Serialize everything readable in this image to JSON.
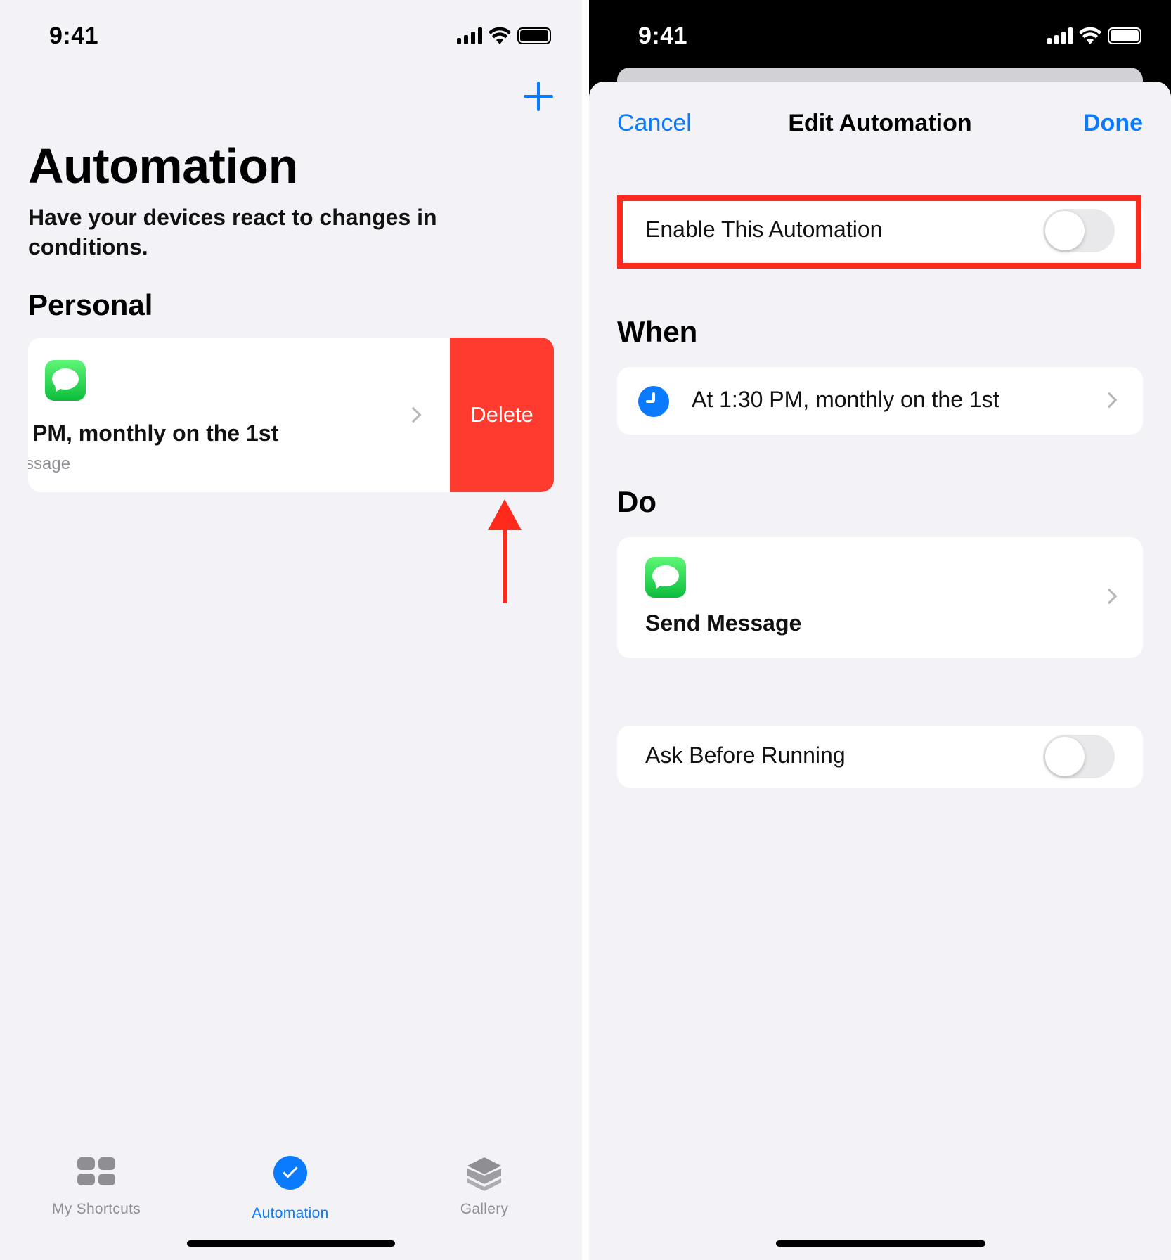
{
  "left": {
    "status": {
      "time": "9:41"
    },
    "header": {
      "title": "Automation",
      "subtitle": "Have your devices react to changes in conditions."
    },
    "section": "Personal",
    "card": {
      "title": "PM, monthly on the 1st",
      "subtitle": "ssage",
      "delete_label": "Delete"
    },
    "tabs": [
      {
        "label": "My Shortcuts",
        "icon": "grid-icon",
        "active": false
      },
      {
        "label": "Automation",
        "icon": "clock-check-icon",
        "active": true
      },
      {
        "label": "Gallery",
        "icon": "layers-icon",
        "active": false
      }
    ]
  },
  "right": {
    "status": {
      "time": "9:41"
    },
    "nav": {
      "cancel": "Cancel",
      "title": "Edit Automation",
      "done": "Done"
    },
    "enable": {
      "label": "Enable This Automation",
      "on": false
    },
    "when": {
      "heading": "When",
      "label": "At 1:30 PM, monthly on the 1st"
    },
    "do": {
      "heading": "Do",
      "label": "Send Message"
    },
    "ask": {
      "label": "Ask Before Running",
      "on": false
    }
  },
  "colors": {
    "accent": "#0a7aff",
    "delete": "#ff3b30",
    "highlight": "#ff2a1b",
    "background": "#f2f2f7"
  }
}
